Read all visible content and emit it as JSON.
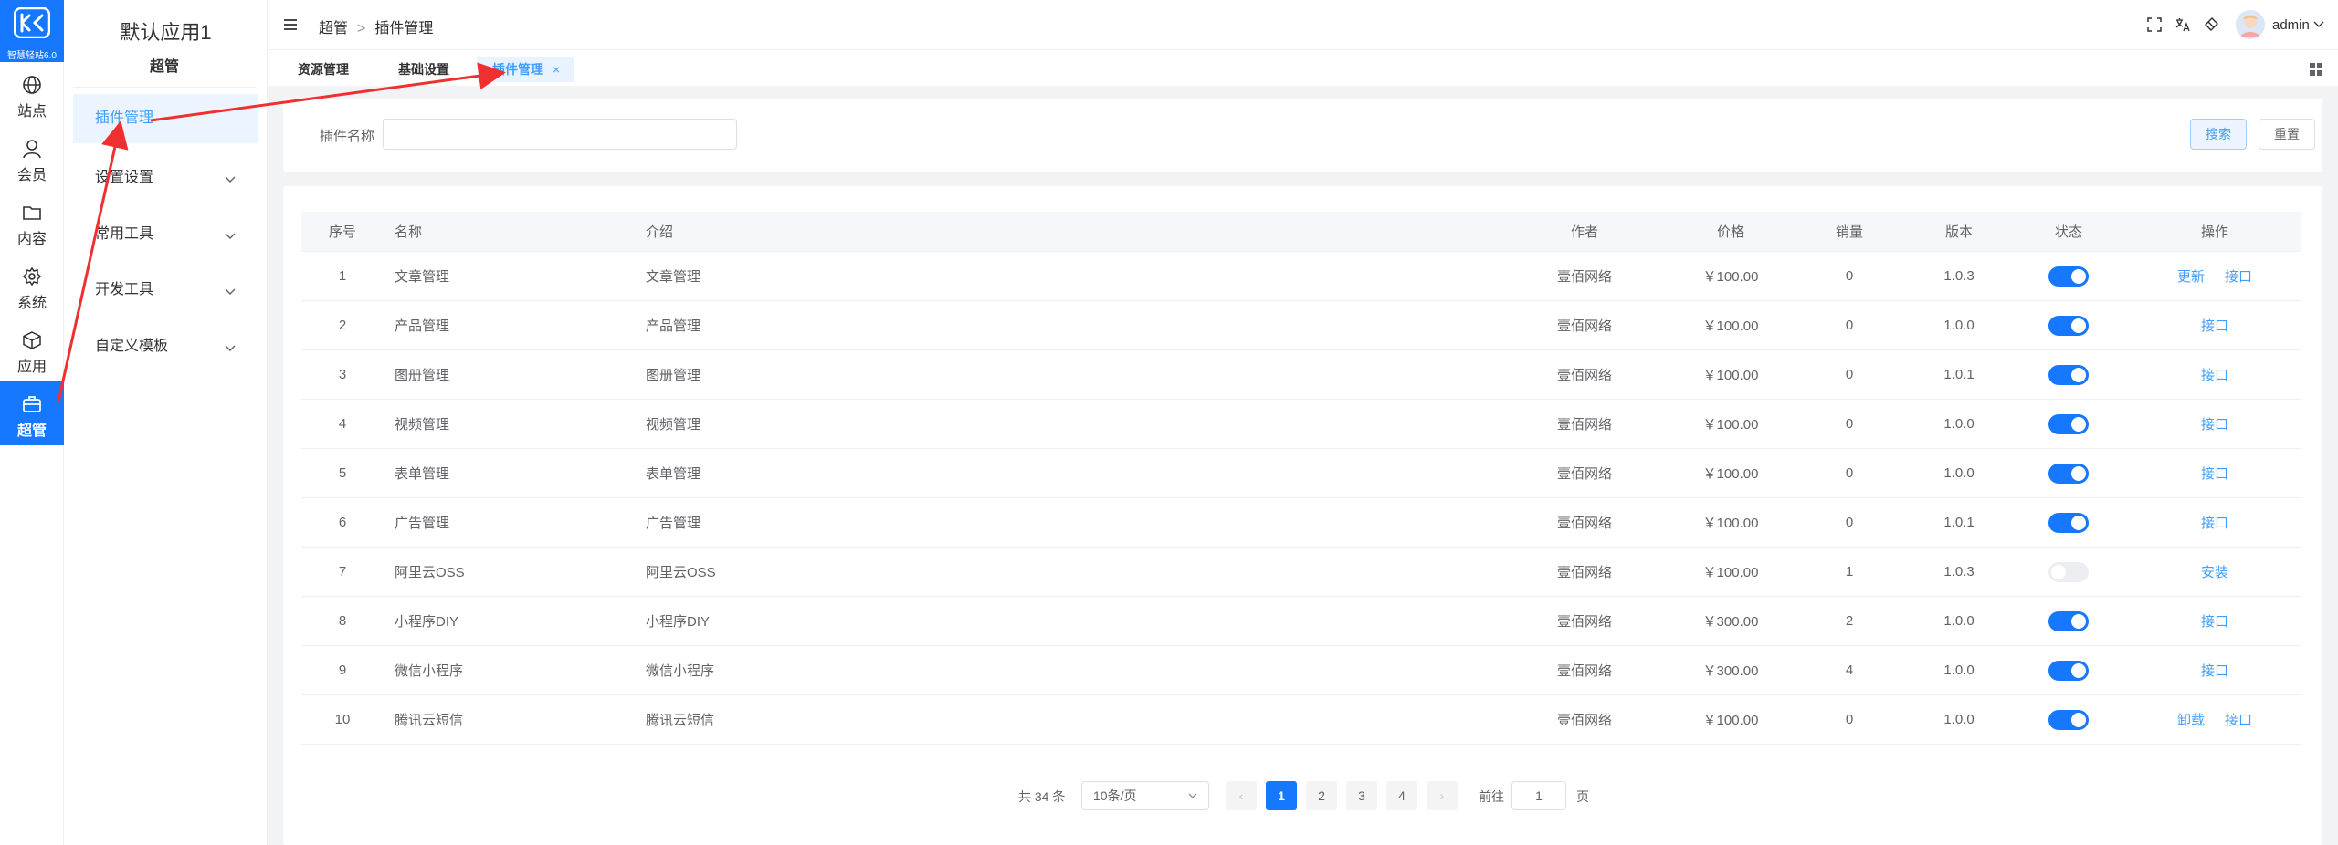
{
  "brand": {
    "logo_text": "智慧轻站6.0",
    "color": "#1677ff"
  },
  "iconbar": {
    "items": [
      {
        "label": "站点",
        "icon": "globe-icon"
      },
      {
        "label": "会员",
        "icon": "user-icon"
      },
      {
        "label": "内容",
        "icon": "folder-icon"
      },
      {
        "label": "系统",
        "icon": "gear-icon"
      },
      {
        "label": "应用",
        "icon": "cube-icon"
      },
      {
        "label": "超管",
        "icon": "briefcase-icon",
        "active": true
      }
    ]
  },
  "sidebar": {
    "title": "默认应用1",
    "subtitle": "超管",
    "items": [
      {
        "label": "插件管理",
        "active": true
      },
      {
        "label": "设置设置",
        "expandable": true
      },
      {
        "label": "常用工具",
        "expandable": true
      },
      {
        "label": "开发工具",
        "expandable": true
      },
      {
        "label": "自定义模板",
        "expandable": true
      }
    ]
  },
  "header": {
    "breadcrumb": [
      "超管",
      "插件管理"
    ],
    "breadcrumb_sep": ">",
    "username": "admin",
    "icons": [
      "fullscreen-icon",
      "translate-icon",
      "clear-cache-icon",
      "chevron-down-icon"
    ]
  },
  "tabs": [
    {
      "label": "资源管理"
    },
    {
      "label": "基础设置"
    },
    {
      "label": "插件管理",
      "active": true,
      "close": "×"
    }
  ],
  "search": {
    "label": "插件名称",
    "placeholder": "",
    "value": "",
    "search_btn": "搜索",
    "reset_btn": "重置"
  },
  "table": {
    "columns": [
      "序号",
      "名称",
      "介绍",
      "作者",
      "价格",
      "销量",
      "版本",
      "状态",
      "操作"
    ],
    "rows": [
      {
        "idx": "1",
        "name": "文章管理",
        "intro": "文章管理",
        "author": "壹佰网络",
        "price": "￥100.00",
        "sales": "0",
        "version": "1.0.3",
        "enabled": true,
        "ops": [
          "更新",
          "接口"
        ]
      },
      {
        "idx": "2",
        "name": "产品管理",
        "intro": "产品管理",
        "author": "壹佰网络",
        "price": "￥100.00",
        "sales": "0",
        "version": "1.0.0",
        "enabled": true,
        "ops": [
          "接口"
        ]
      },
      {
        "idx": "3",
        "name": "图册管理",
        "intro": "图册管理",
        "author": "壹佰网络",
        "price": "￥100.00",
        "sales": "0",
        "version": "1.0.1",
        "enabled": true,
        "ops": [
          "接口"
        ]
      },
      {
        "idx": "4",
        "name": "视频管理",
        "intro": "视频管理",
        "author": "壹佰网络",
        "price": "￥100.00",
        "sales": "0",
        "version": "1.0.0",
        "enabled": true,
        "ops": [
          "接口"
        ]
      },
      {
        "idx": "5",
        "name": "表单管理",
        "intro": "表单管理",
        "author": "壹佰网络",
        "price": "￥100.00",
        "sales": "0",
        "version": "1.0.0",
        "enabled": true,
        "ops": [
          "接口"
        ]
      },
      {
        "idx": "6",
        "name": "广告管理",
        "intro": "广告管理",
        "author": "壹佰网络",
        "price": "￥100.00",
        "sales": "0",
        "version": "1.0.1",
        "enabled": true,
        "ops": [
          "接口"
        ]
      },
      {
        "idx": "7",
        "name": "阿里云OSS",
        "intro": "阿里云OSS",
        "author": "壹佰网络",
        "price": "￥100.00",
        "sales": "1",
        "version": "1.0.3",
        "enabled": false,
        "ops": [
          "安装"
        ]
      },
      {
        "idx": "8",
        "name": "小程序DIY",
        "intro": "小程序DIY",
        "author": "壹佰网络",
        "price": "￥300.00",
        "sales": "2",
        "version": "1.0.0",
        "enabled": true,
        "ops": [
          "接口"
        ]
      },
      {
        "idx": "9",
        "name": "微信小程序",
        "intro": "微信小程序",
        "author": "壹佰网络",
        "price": "￥300.00",
        "sales": "4",
        "version": "1.0.0",
        "enabled": true,
        "ops": [
          "接口"
        ]
      },
      {
        "idx": "10",
        "name": "腾讯云短信",
        "intro": "腾讯云短信",
        "author": "壹佰网络",
        "price": "￥100.00",
        "sales": "0",
        "version": "1.0.0",
        "enabled": true,
        "ops": [
          "卸载",
          "接口"
        ]
      }
    ]
  },
  "pagination": {
    "total_text": "共 34 条",
    "page_size": "10条/页",
    "pages": [
      "1",
      "2",
      "3",
      "4"
    ],
    "current": "1",
    "prev": "‹",
    "next": "›",
    "goto_label": "前往",
    "goto_value": "1",
    "page_unit": "页"
  },
  "annotation": {
    "arrow_color": "#f03030"
  }
}
